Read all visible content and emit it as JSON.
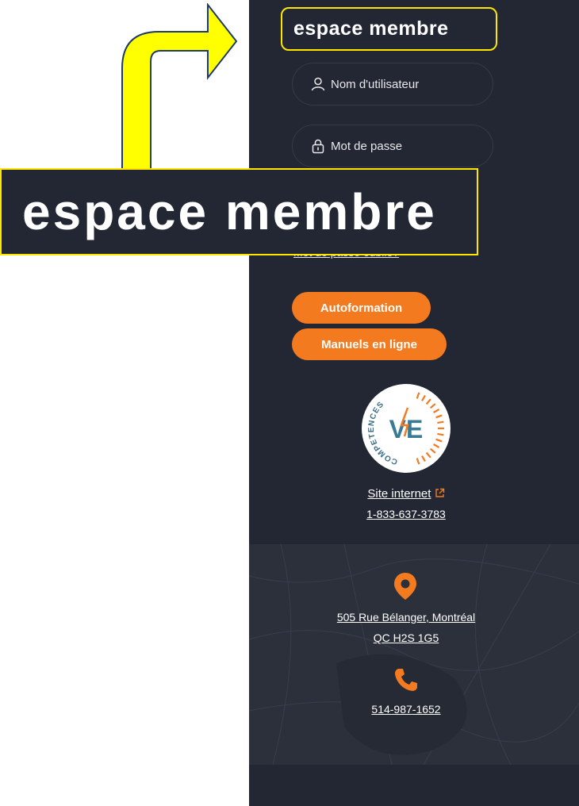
{
  "sidebar": {
    "title": "espace membre",
    "username_placeholder": "Nom d'utilisateur",
    "password_placeholder": "Mot de passe",
    "forgot_password": "Mot de passe oublié?",
    "buttons": {
      "autoformation": "Autoformation",
      "manuels": "Manuels en ligne"
    },
    "logo": {
      "text": "COMPETENCES",
      "monogram": "VE"
    },
    "site_link": "Site internet",
    "site_phone": "1-833-637-3783"
  },
  "footer": {
    "address_line1": "505 Rue Bélanger, Montréal",
    "address_line2": "QC H2S 1G5",
    "phone": "514-987-1652"
  },
  "callout": {
    "text": "espace membre"
  },
  "colors": {
    "panel": "#222733",
    "accent_orange": "#f47a20",
    "highlight_yellow": "#ffe600"
  },
  "icons": [
    "user-icon",
    "lock-icon",
    "external-link-icon",
    "map-pin-icon",
    "phone-icon",
    "arrow-icon"
  ]
}
